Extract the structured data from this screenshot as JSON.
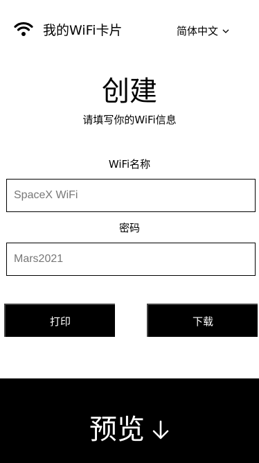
{
  "header": {
    "app_title": "我的WiFi卡片",
    "language": "简体中文"
  },
  "main": {
    "title": "创建",
    "subtitle": "请填写你的WiFi信息"
  },
  "form": {
    "ssid_label": "WiFi名称",
    "ssid_value": "SpaceX WiFi",
    "password_label": "密码",
    "password_value": "Mars2021"
  },
  "actions": {
    "print_label": "打印",
    "download_label": "下载"
  },
  "preview": {
    "label": "预览"
  },
  "icons": {
    "wifi": "wifi-icon",
    "language_dropdown": "chevron-down-icon",
    "preview_arrow": "arrow-down-icon"
  },
  "colors": {
    "background": "#ffffff",
    "text": "#000000",
    "button_bg": "#000000",
    "button_text": "#ffffff",
    "input_text": "#777777"
  }
}
